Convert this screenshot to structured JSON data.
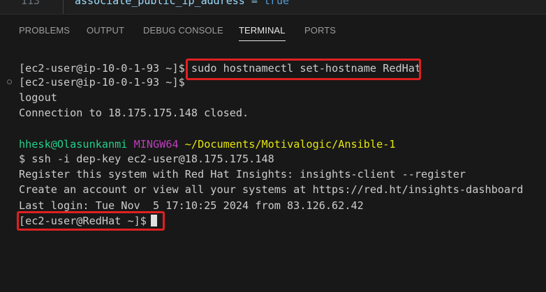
{
  "editor": {
    "line_number": "113",
    "code_key": "associate_public_ip_address",
    "code_eq": " = ",
    "code_value": "true",
    "code_line2": "            "
  },
  "tabs": [
    {
      "label": "PROBLEMS",
      "active": false
    },
    {
      "label": "OUTPUT",
      "active": false
    },
    {
      "label": "DEBUG CONSOLE",
      "active": false
    },
    {
      "label": "TERMINAL",
      "active": true
    },
    {
      "label": "PORTS",
      "active": false
    }
  ],
  "terminal": {
    "line1_prompt": "[ec2-user@ip-10-0-1-93 ~]$",
    "line1_cmd": "sudo hostnamectl set-hostname RedHat",
    "line2_prompt": "[ec2-user@ip-10-0-1-93 ~]$",
    "line3": "logout",
    "line4": "Connection to 18.175.175.148 closed.",
    "line6_user": "hhesk@Olasunkanmi",
    "line6_env": "MINGW64",
    "line6_path": "~/Documents/Motivalogic/Ansible-1",
    "line7": "$ ssh -i dep-key ec2-user@18.175.175.148",
    "line8": "Register this system with Red Hat Insights: insights-client --register",
    "line9": "Create an account or view all your systems at https://red.ht/insights-dashboard",
    "line10": "Last login: Tue Nov  5 17:10:25 2024 from 83.126.62.42",
    "line11_prompt": "[ec2-user@RedHat ~]$"
  },
  "colors": {
    "annotation": "#e02020",
    "user_host": "#23d18b",
    "env": "#bc3fbc",
    "path": "#e5e510"
  }
}
